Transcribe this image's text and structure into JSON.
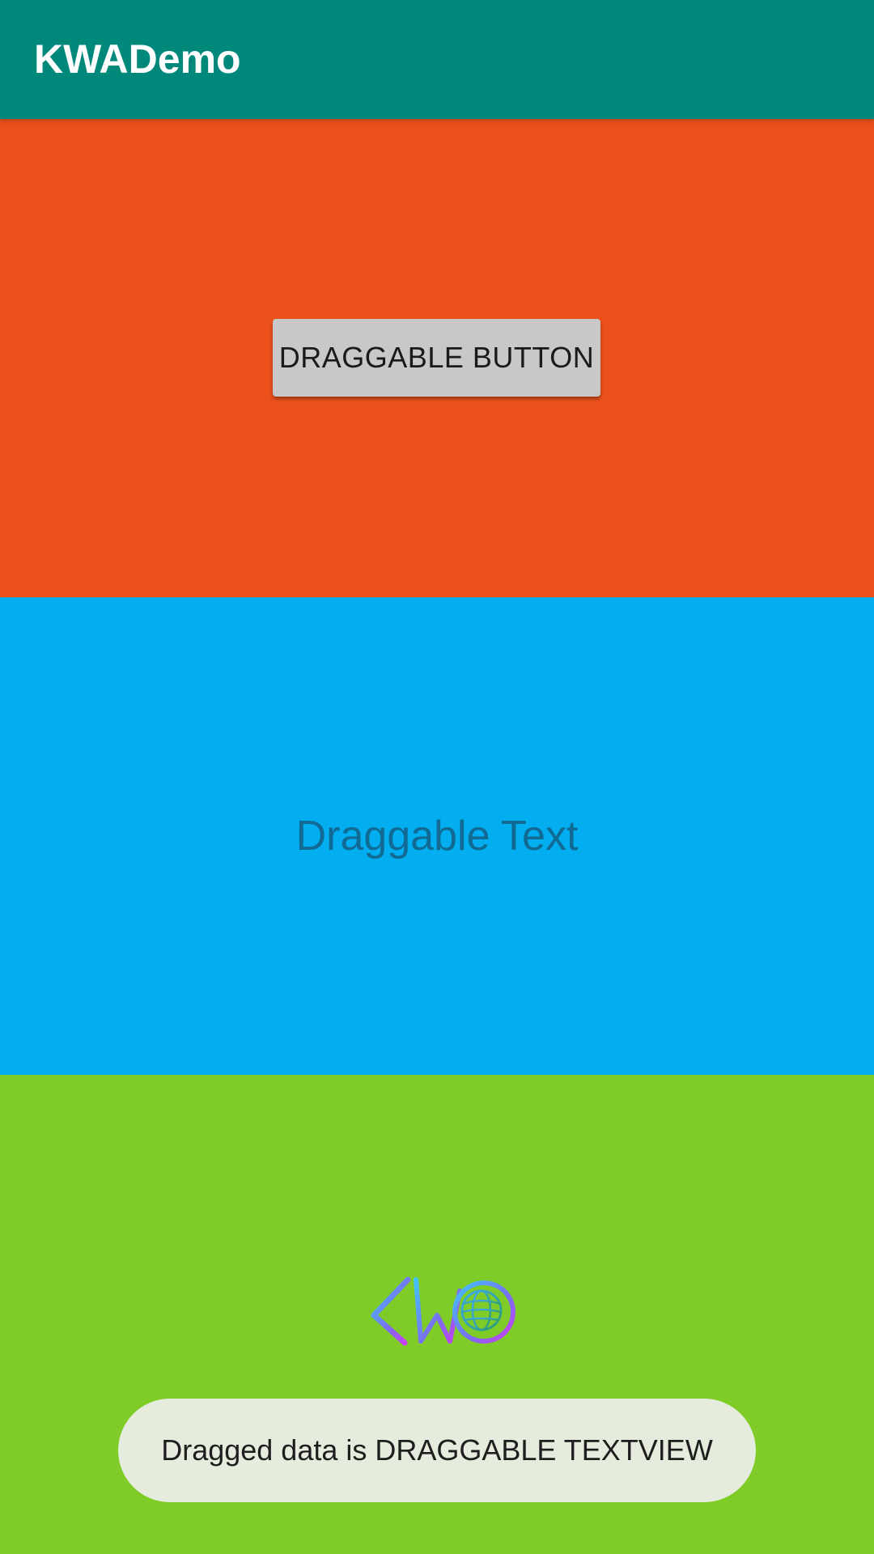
{
  "app_bar": {
    "title": "KWADemo",
    "color": "#00897B"
  },
  "drop_zones": {
    "orange_color": "#EC511C",
    "blue_color": "#02AEEF",
    "green_color": "#7FCC29"
  },
  "draggable_button": {
    "label": "DRAGGABLE BUTTON"
  },
  "draggable_text": {
    "text": "Draggable Text"
  },
  "logo": {
    "text": "KW",
    "icon": "kw-globe-logo-icon"
  },
  "toast": {
    "message": "Dragged data is DRAGGABLE TEXTVIEW"
  }
}
